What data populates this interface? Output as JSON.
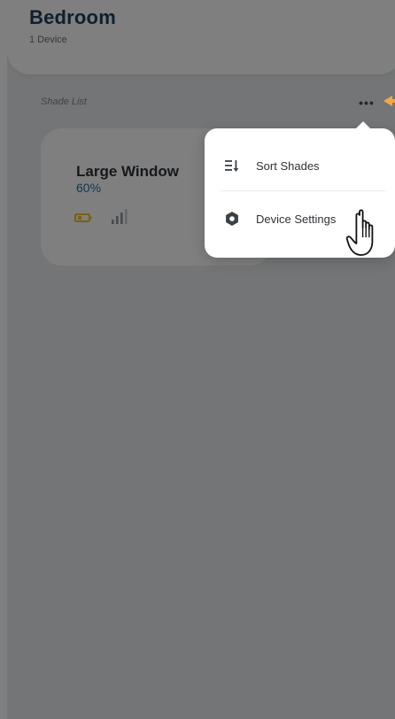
{
  "room": {
    "name": "Bedroom",
    "device_count": "1 Device"
  },
  "shade_list": {
    "label": "Shade List",
    "more_button": "•••",
    "items": [
      {
        "name": "Large Window",
        "level": "60%"
      }
    ]
  },
  "menu": {
    "items": [
      {
        "label": "Sort Shades",
        "icon": "sort-icon"
      },
      {
        "label": "Device Settings",
        "icon": "settings-gear-icon"
      }
    ]
  },
  "colors": {
    "title": "#1f3f5c",
    "level_text": "#1e6fa3",
    "battery_warning": "#f0c419",
    "highlight_arrow": "#f4a742",
    "overlay": "rgba(0,0,0,0.50)"
  }
}
